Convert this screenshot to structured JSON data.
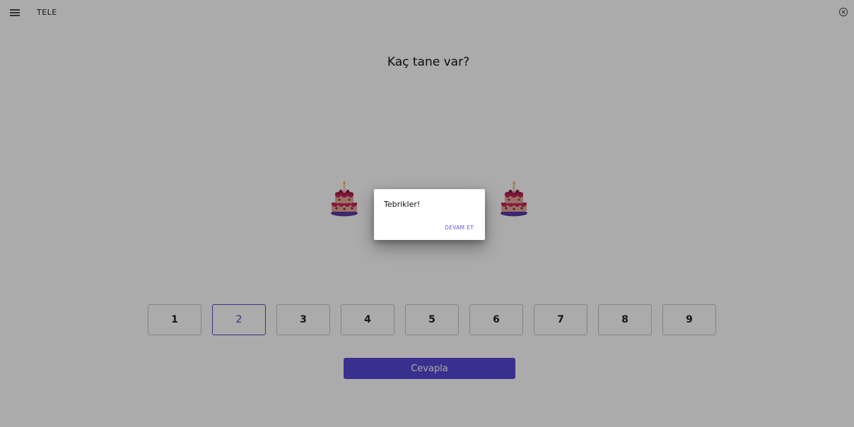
{
  "header": {
    "title": "TELE",
    "menu_icon": "hamburger-menu-icon",
    "close_icon": "close-circle-icon"
  },
  "question": "Kaç tane var?",
  "items": {
    "count": 2,
    "icon": "cake-icon"
  },
  "choices": [
    {
      "label": "1",
      "selected": false
    },
    {
      "label": "2",
      "selected": true
    },
    {
      "label": "3",
      "selected": false
    },
    {
      "label": "4",
      "selected": false
    },
    {
      "label": "5",
      "selected": false
    },
    {
      "label": "6",
      "selected": false
    },
    {
      "label": "7",
      "selected": false
    },
    {
      "label": "8",
      "selected": false
    },
    {
      "label": "9",
      "selected": false
    }
  ],
  "answer_button": "Cevapla",
  "dialog": {
    "title": "Tebrikler!",
    "button": "DEVAM ET"
  },
  "colors": {
    "accent": "#5646d4",
    "overlay": "rgba(0,0,0,0.33)"
  }
}
